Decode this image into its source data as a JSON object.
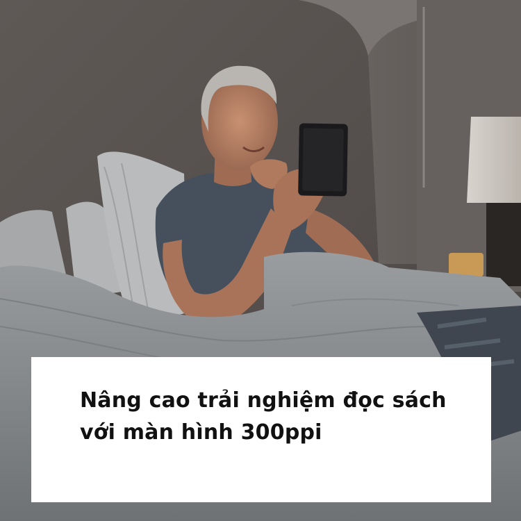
{
  "caption": {
    "line1": "Nâng cao trải nghiệm đọc sách",
    "line2": "với màn hình 300ppi"
  },
  "photo": {
    "icons": [
      "man-figure-icon",
      "ereader-icon",
      "lamp-icon",
      "pillow-icon",
      "blanket-icon"
    ],
    "colors": {
      "wall": "#5d5755",
      "bedding": "#8e9193",
      "skin": "#b27a5c",
      "shirt": "#45505c",
      "screen": "#1a1a1c",
      "lamp_shade": "#d9d4ce",
      "caption_bg": "#ffffff",
      "caption_text": "#111111"
    }
  }
}
